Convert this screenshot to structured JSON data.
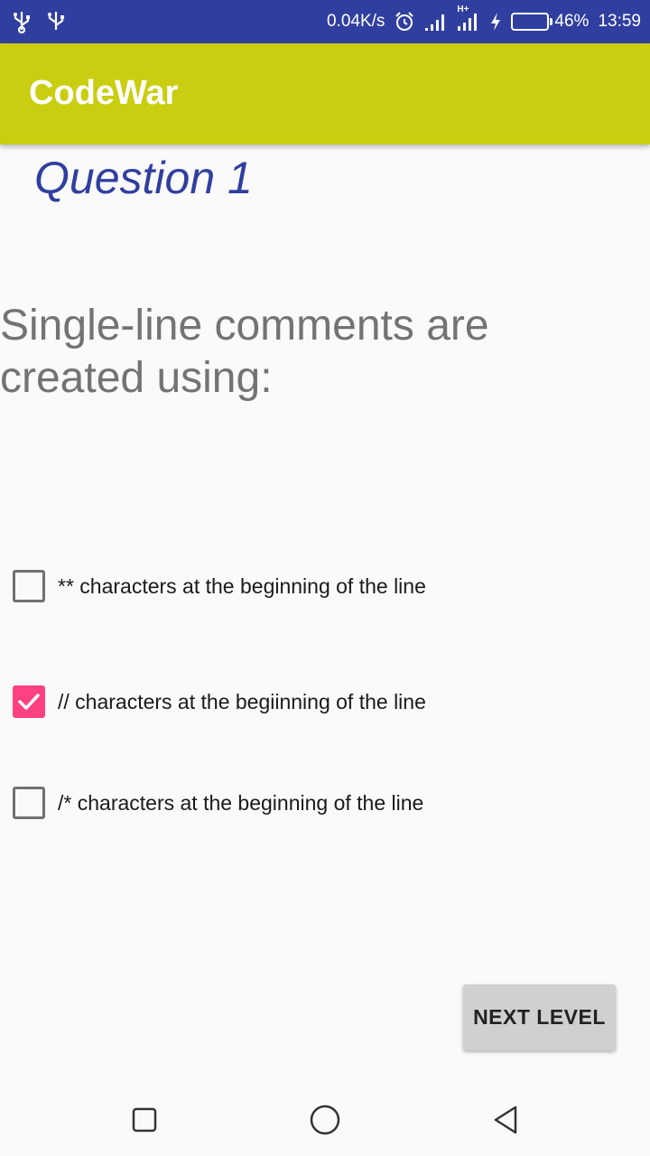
{
  "status_bar": {
    "net_speed": "0.04K/s",
    "network_type": "H+",
    "battery_percent": "46%",
    "battery_level": 0.46,
    "time": "13:59",
    "icons": [
      "usb-icon",
      "usb-icon",
      "alarm-icon",
      "signal-icon",
      "signal-icon",
      "charging-icon",
      "battery-icon"
    ]
  },
  "app_bar": {
    "title": "CodeWar",
    "color": "#c9ce10"
  },
  "question": {
    "title": "Question 1",
    "text": "Single-line comments are created using:"
  },
  "options": [
    {
      "label": "** characters at the beginning of the line",
      "checked": false
    },
    {
      "label": "// characters at the begiinning of the line",
      "checked": true
    },
    {
      "label": "/* characters at the beginning of the line",
      "checked": false
    }
  ],
  "next_button": {
    "label": "NEXT LEVEL"
  },
  "nav_bar": {
    "icons": [
      "recents-icon",
      "home-icon",
      "back-icon"
    ]
  },
  "colors": {
    "status_bar": "#303f9f",
    "accent": "#ff4081",
    "question_title": "#303f9f"
  }
}
